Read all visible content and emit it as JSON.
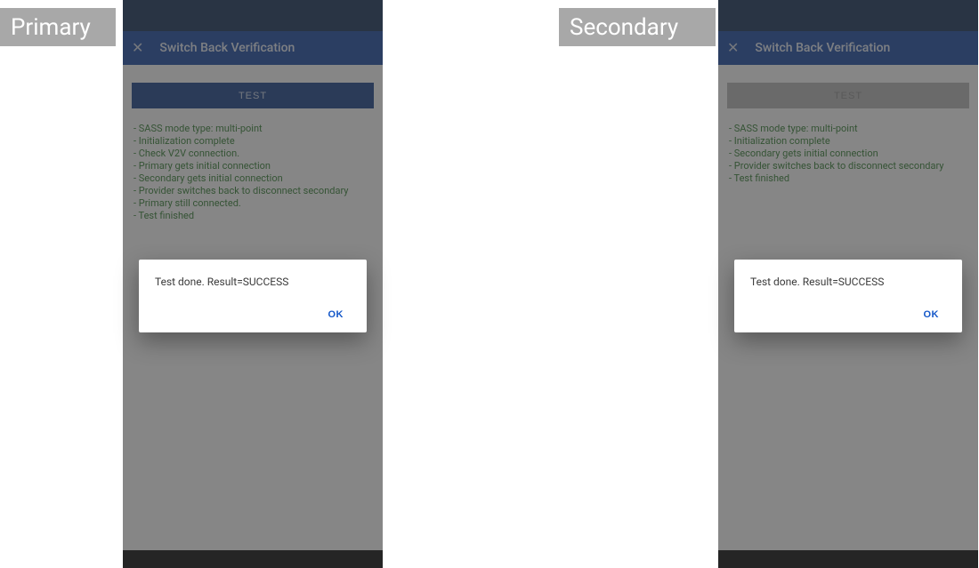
{
  "badges": {
    "primary": "Primary",
    "secondary": "Secondary"
  },
  "toolbar": {
    "title": "Switch Back Verification",
    "close_glyph": "✕"
  },
  "test_button_label": "TEST",
  "dialog": {
    "message": "Test done. Result=SUCCESS",
    "ok_label": "OK"
  },
  "primary_log": [
    "- SASS mode type: multi-point",
    "- Initialization complete",
    "- Check V2V connection.",
    "- Primary gets initial connection",
    "- Secondary gets initial connection",
    "- Provider switches back to disconnect secondary",
    "- Primary still connected.",
    "- Test finished"
  ],
  "secondary_log": [
    "- SASS mode type: multi-point",
    "- Initialization complete",
    "- Secondary gets initial connection",
    "- Provider switches back to disconnect secondary",
    "- Test finished"
  ]
}
